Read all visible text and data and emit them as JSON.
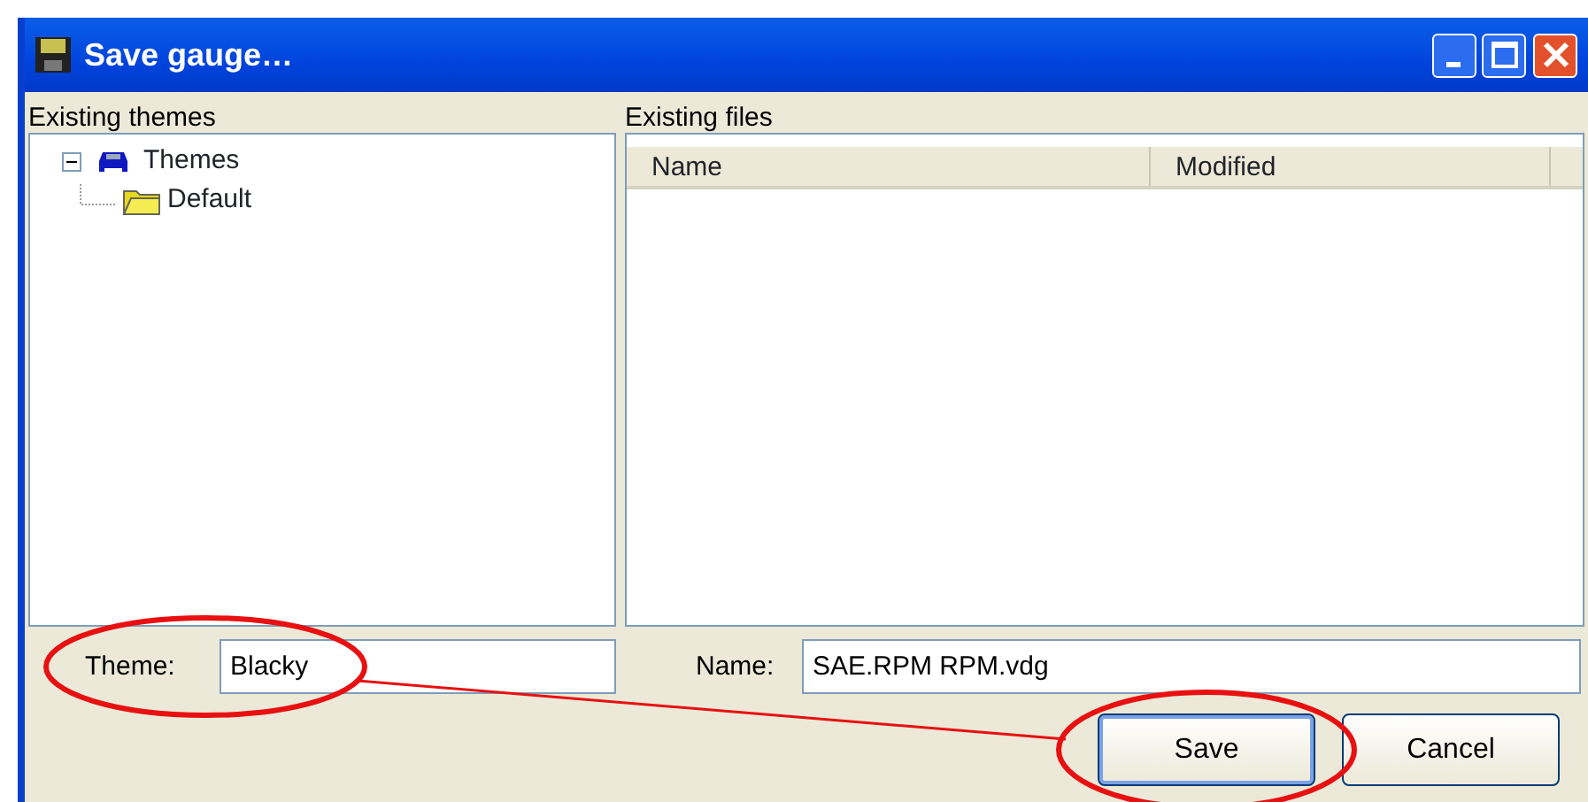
{
  "window": {
    "title": "Save gauge…"
  },
  "themes_panel": {
    "label": "Existing themes",
    "tree": [
      {
        "label": "Themes",
        "expanded": true,
        "children": [
          {
            "label": "Default"
          }
        ]
      }
    ]
  },
  "files_panel": {
    "label": "Existing files",
    "columns": [
      "Name",
      "Modified"
    ]
  },
  "theme_field": {
    "label": "Theme:",
    "value": "Blacky",
    "annotated": true
  },
  "name_field": {
    "label": "Name:",
    "value": "SAE.RPM RPM.vdg"
  },
  "buttons": [
    {
      "label": "Save",
      "default": true,
      "annotated": true
    },
    {
      "label": "Cancel",
      "default": false,
      "annotated": false
    }
  ]
}
